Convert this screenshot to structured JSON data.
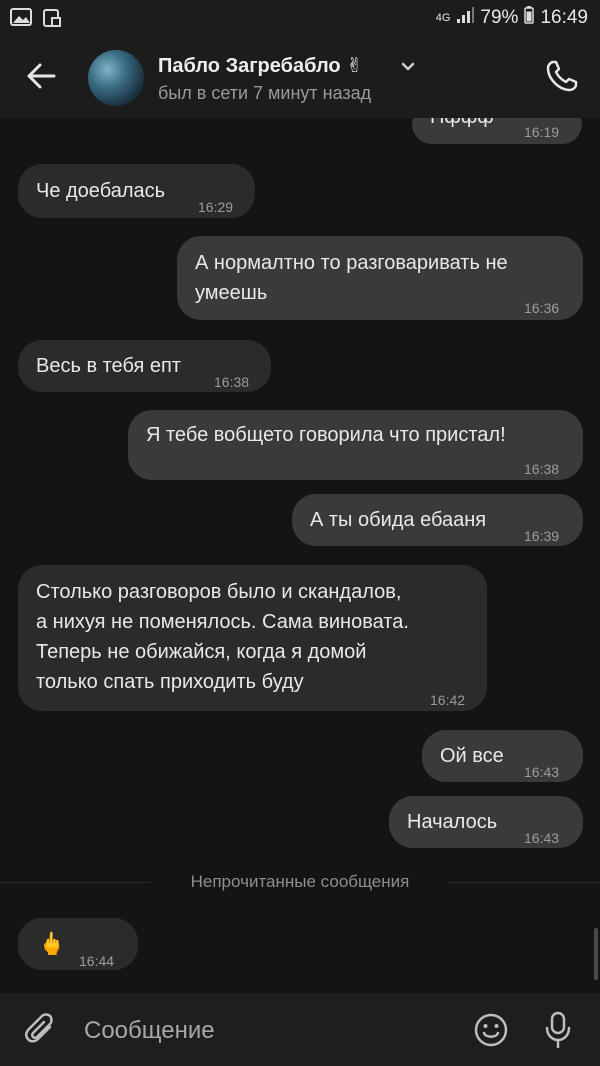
{
  "status_bar": {
    "network": "4G",
    "battery_percent": "79%",
    "time": "16:49"
  },
  "header": {
    "contact_name": "Пабло Загребабло ✌",
    "last_seen": "был в сети 7 минут назад"
  },
  "messages": [
    {
      "text": "Пффф",
      "time": "16:19",
      "direction": "out"
    },
    {
      "text": "Че доебалась",
      "time": "16:29",
      "direction": "in"
    },
    {
      "text": "А нормалтно то разговаривать не\nумеешь",
      "time": "16:36",
      "direction": "out"
    },
    {
      "text": "Весь в тебя епт",
      "time": "16:38",
      "direction": "in"
    },
    {
      "text": "Я тебе вобщето говорила что пристал!",
      "time": "16:38",
      "direction": "out"
    },
    {
      "text": "А ты обида ебааня",
      "time": "16:39",
      "direction": "out"
    },
    {
      "text": "Столько разговоров было и скандалов,\nа нихуя не поменялось. Сама виновата.\nТеперь не обижайся, когда я домой\nтолько спать приходить буду",
      "time": "16:42",
      "direction": "in"
    },
    {
      "text": "Ой все",
      "time": "16:43",
      "direction": "out"
    },
    {
      "text": "Началось",
      "time": "16:43",
      "direction": "out"
    },
    {
      "text": "🖕",
      "time": "16:44",
      "direction": "in"
    }
  ],
  "unread_divider": "Непрочитанные сообщения",
  "composer": {
    "placeholder": "Сообщение"
  },
  "icons": [
    "image-icon",
    "screenshot-icon",
    "signal-icon",
    "back-arrow-icon",
    "chevron-down-icon",
    "phone-icon",
    "attach-icon",
    "emoji-icon",
    "microphone-icon"
  ],
  "colors": {
    "background": "#141414",
    "bar": "#1c1c1c",
    "bubble_in": "#2b2b2b",
    "bubble_out": "#3a3a3a"
  }
}
